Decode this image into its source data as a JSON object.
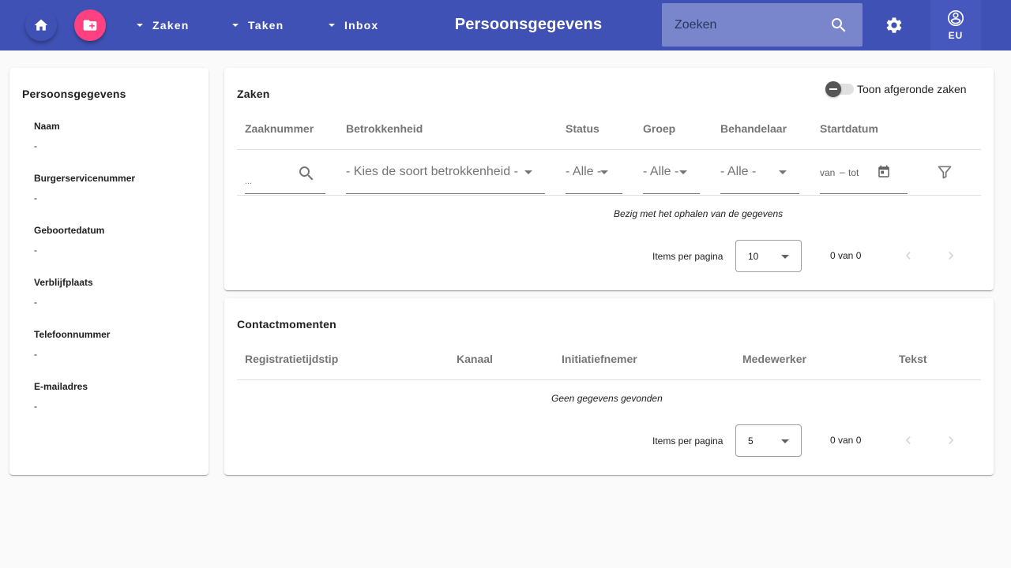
{
  "toolbar": {
    "home_icon": "home-icon",
    "new_case_icon": "folder-plus-icon",
    "menus": [
      {
        "label": "Zaken"
      },
      {
        "label": "Taken"
      },
      {
        "label": "Inbox"
      }
    ],
    "title": "Persoonsgegevens",
    "search_placeholder": "Zoeken",
    "search_icon": "search-icon",
    "settings_icon": "gear-icon",
    "user_icon": "account-circle-icon",
    "user_initials": "EU"
  },
  "colors": {
    "primary": "#3f51b5",
    "accent": "#ff4081",
    "search_bg": "#7986cb"
  },
  "person": {
    "title": "Persoonsgegevens",
    "fields": [
      {
        "label": "Naam",
        "value": "-"
      },
      {
        "label": "Burgerservicenummer",
        "value": "-"
      },
      {
        "label": "Geboortedatum",
        "value": "-"
      },
      {
        "label": "Verblijfplaats",
        "value": "-"
      },
      {
        "label": "Telefoonnummer",
        "value": "-"
      },
      {
        "label": "E-mailadres",
        "value": "-"
      }
    ]
  },
  "zaken": {
    "title": "Zaken",
    "toggle_label": "Toon afgeronde zaken",
    "toggle_checked": false,
    "columns": [
      "Zaaknummer",
      "Betrokkenheid",
      "Status",
      "Groep",
      "Behandelaar",
      "Startdatum"
    ],
    "filters": {
      "zaaknummer_placeholder": "...",
      "betrokkenheid": "- Kies de soort betrokkenheid -",
      "status": "- Alle -",
      "groep": "- Alle -",
      "behandelaar": "- Alle -",
      "date_from": "van",
      "date_to": "tot"
    },
    "message": "Bezig met het ophalen van de gegevens",
    "paginator": {
      "label": "Items per pagina",
      "page_size": "10",
      "range": "0 van 0"
    }
  },
  "contact": {
    "title": "Contactmomenten",
    "columns": [
      "Registratietijdstip",
      "Kanaal",
      "Initiatiefnemer",
      "Medewerker",
      "Tekst"
    ],
    "message": "Geen gegevens gevonden",
    "paginator": {
      "label": "Items per pagina",
      "page_size": "5",
      "range": "0 van 0"
    }
  }
}
